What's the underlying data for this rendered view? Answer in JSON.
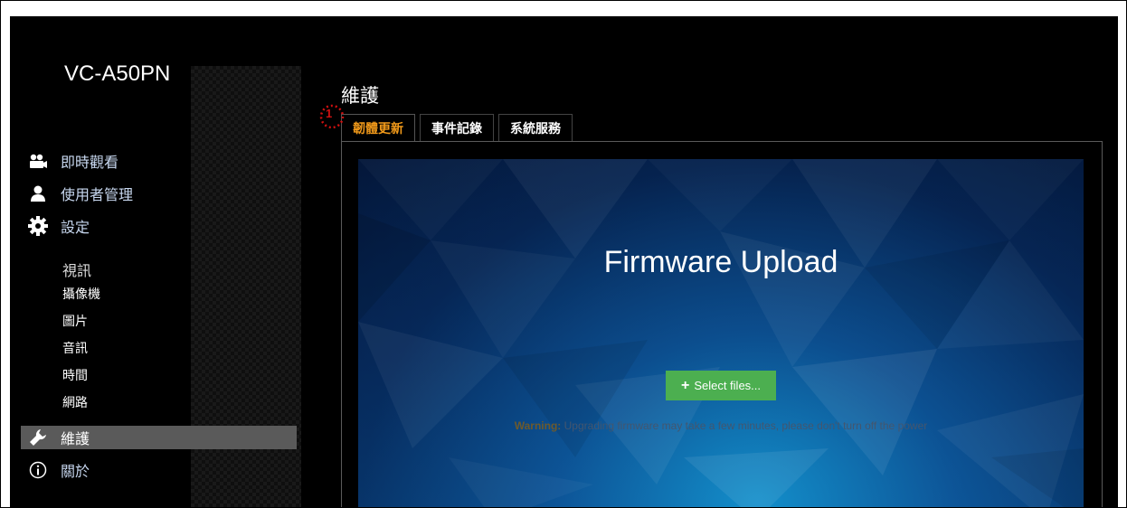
{
  "app": {
    "model": "VC-A50PN"
  },
  "sidebar": {
    "items": [
      {
        "label": "即時觀看",
        "icon": "camera-icon"
      },
      {
        "label": "使用者管理",
        "icon": "user-icon"
      },
      {
        "label": "設定",
        "icon": "gear-icon"
      },
      {
        "label": "維護",
        "icon": "wrench-icon"
      },
      {
        "label": "關於",
        "icon": "info-icon"
      }
    ],
    "sub_items": [
      "視訊",
      "攝像機",
      "圖片",
      "音訊",
      "時間",
      "網路"
    ],
    "active_item": "維護"
  },
  "main": {
    "title": "維護",
    "tabs": [
      {
        "label": "韌體更新",
        "active": true
      },
      {
        "label": "事件記錄",
        "active": false
      },
      {
        "label": "系統服務",
        "active": false
      }
    ],
    "upload": {
      "title": "Firmware Upload",
      "button_label": "Select files...",
      "warning_label": "Warning:",
      "warning_text": "Upgrading firmware may take a few minutes, please don't turn off the power"
    }
  },
  "callout": {
    "number": "1"
  },
  "colors": {
    "active_tab": "#f29a1a",
    "button_green": "#4caf50",
    "callout_red": "#d01010",
    "sidebar_active_bg": "#5a5a5a"
  }
}
